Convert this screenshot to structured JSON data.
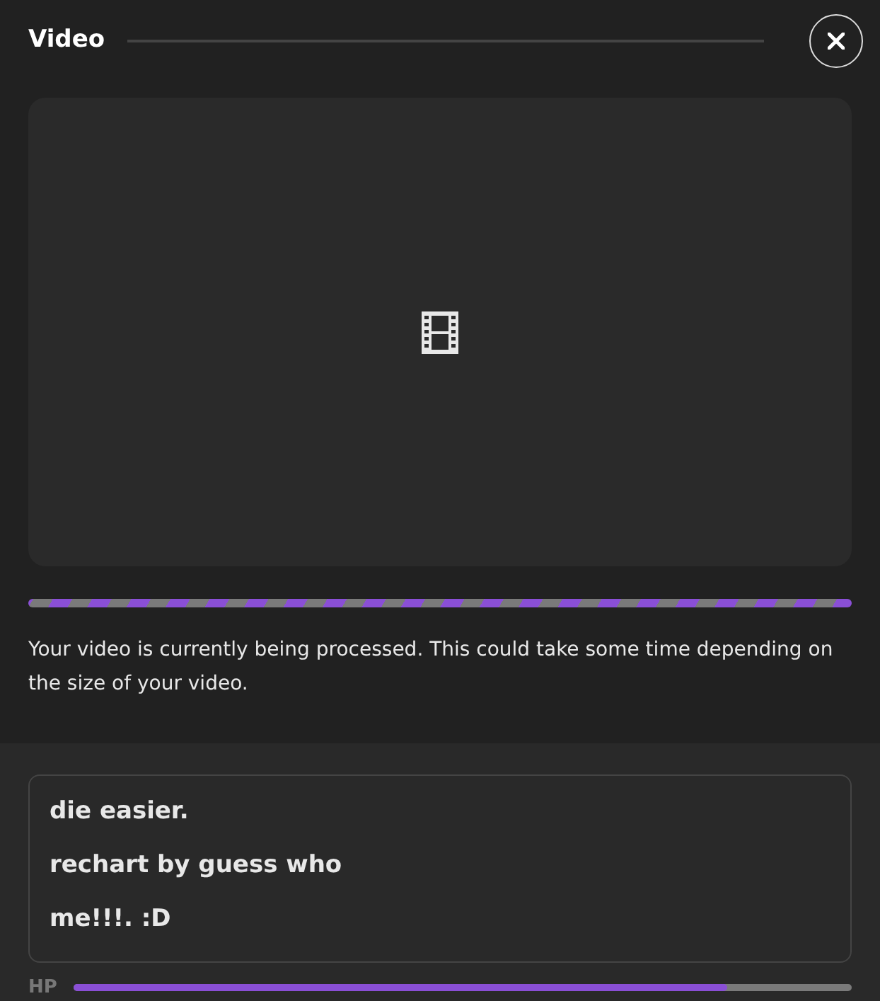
{
  "dialog": {
    "title": "Video"
  },
  "processing": {
    "kind": "indeterminate",
    "message": "Your video is currently being processed. This could take some time depending on the size of your video."
  },
  "text_box": {
    "lines": [
      "die easier.",
      "rechart by guess who",
      "me!!!. :D"
    ]
  },
  "hp_bar": {
    "label": "HP",
    "level": 0.84
  }
}
